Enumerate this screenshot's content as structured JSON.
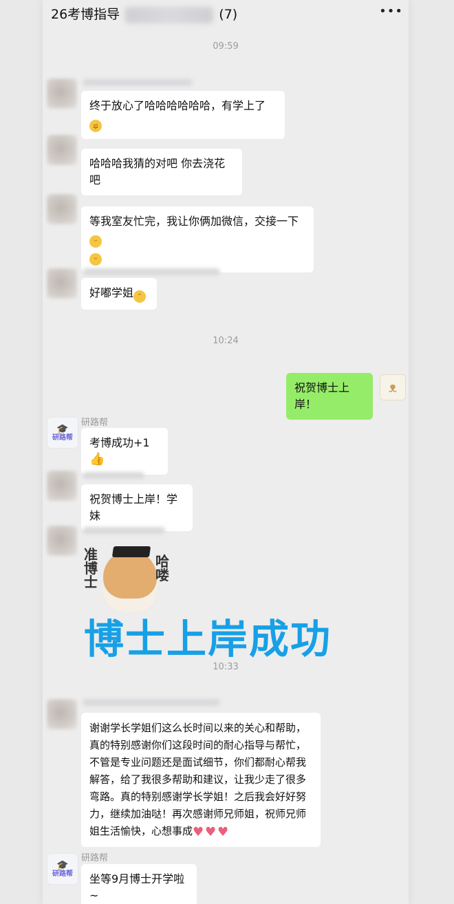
{
  "header": {
    "title_prefix": "26考博指导",
    "title_suffix": "(7)",
    "more_icon": "more-dots-icon"
  },
  "timestamps": [
    "09:59",
    "10:24",
    "10:33"
  ],
  "messages": [
    {
      "text": "终于放心了哈哈哈哈哈哈，有学上了",
      "emoji": "😭"
    },
    {
      "text": "哈哈哈我猜的对吧 你去浇花吧"
    },
    {
      "text_line1": "等我室友忙完，我让你俩加微信，交接一下",
      "emoji1": "😁",
      "emoji2": "😁"
    },
    {
      "text": "好嘟学姐",
      "emoji": "😊"
    },
    {
      "text": "祝贺博士上岸！",
      "from": "me"
    },
    {
      "sender": "研路帮",
      "text": "考博成功+1",
      "emoji": "👍"
    },
    {
      "text": "祝贺博士上岸！学妹"
    },
    {
      "sticker": {
        "left_text": "准博士",
        "right_text": "哈喽",
        "main_text": "博士上岸成功"
      }
    },
    {
      "lines": [
        "谢谢学长学姐们这么长时间以来的关心和帮助，",
        "真的特别感谢你们这段时间的耐心指导与帮忙，",
        "不管是专业问题还是面试细节，你们都耐心帮我",
        "解答，给了我很多帮助和建议，让我少走了很多",
        "弯路。真的特别感谢学长学姐！之后我会好好努",
        "力，继续加油哒！再次感谢师兄师姐，祝师兄师",
        "姐生活愉快，心想事成"
      ]
    },
    {
      "sender": "研路帮",
      "text": "坐等9月博士开学啦~"
    }
  ],
  "logo": {
    "text": "研路帮",
    "hat_icon": "graduation-cap-icon"
  }
}
